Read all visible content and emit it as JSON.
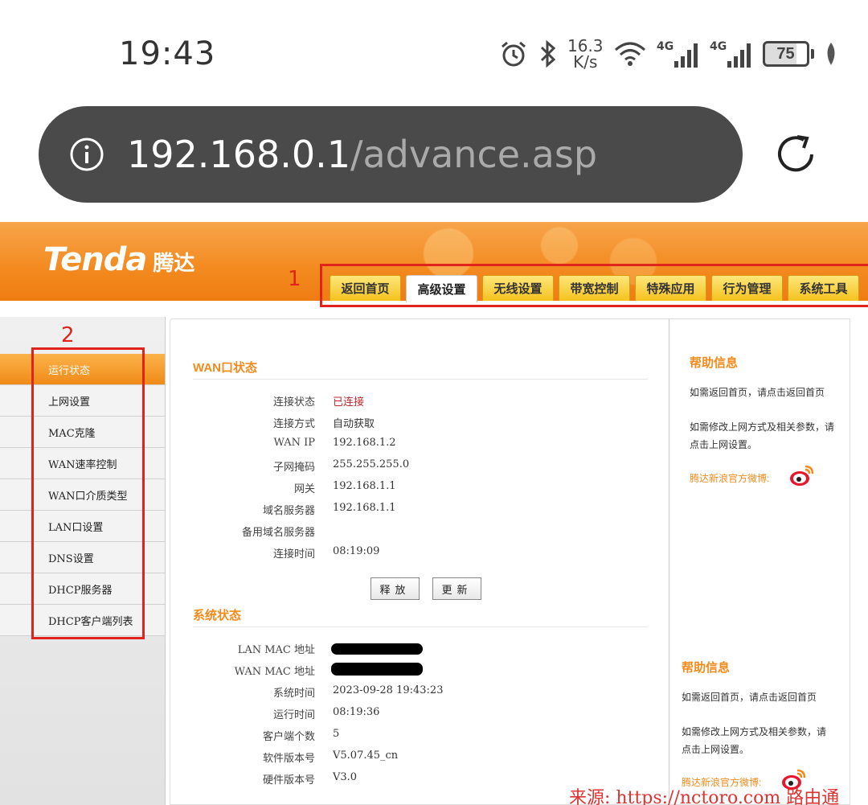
{
  "status_bar": {
    "time": "19:43",
    "net_speed_value": "16.3",
    "net_speed_unit": "K/s",
    "signal1_label": "4G",
    "signal2_label": "4G",
    "battery": "75"
  },
  "browser": {
    "url_host": "192.168.0.1",
    "url_path": "/advance.asp"
  },
  "router": {
    "brand_logo": "Tenda",
    "brand_cn": "腾达",
    "annotation_1": "1",
    "annotation_2": "2",
    "tabs": [
      {
        "label": "返回首页"
      },
      {
        "label": "高级设置",
        "active": true
      },
      {
        "label": "无线设置"
      },
      {
        "label": "带宽控制"
      },
      {
        "label": "特殊应用"
      },
      {
        "label": "行为管理"
      },
      {
        "label": "系统工具"
      }
    ],
    "sidebar": [
      {
        "label": "运行状态",
        "active": true
      },
      {
        "label": "上网设置"
      },
      {
        "label": "MAC克隆"
      },
      {
        "label": "WAN速率控制"
      },
      {
        "label": "WAN口介质类型"
      },
      {
        "label": "LAN口设置"
      },
      {
        "label": "DNS设置"
      },
      {
        "label": "DHCP服务器"
      },
      {
        "label": "DHCP客户端列表"
      }
    ],
    "wan_section": {
      "title": "WAN口状态",
      "rows": [
        {
          "label": "连接状态",
          "value": "已连接"
        },
        {
          "label": "连接方式",
          "value": "自动获取"
        },
        {
          "label": "WAN IP",
          "value": "192.168.1.2"
        },
        {
          "label": "子网掩码",
          "value": "255.255.255.0"
        },
        {
          "label": "网关",
          "value": "192.168.1.1"
        },
        {
          "label": "域名服务器",
          "value": "192.168.1.1"
        },
        {
          "label": "备用域名服务器",
          "value": ""
        },
        {
          "label": "连接时间",
          "value": "08:19:09"
        }
      ],
      "release_button": "释放",
      "renew_button": "更新"
    },
    "system_section": {
      "title": "系统状态",
      "rows": [
        {
          "label": "LAN MAC 地址",
          "value": ""
        },
        {
          "label": "WAN MAC 地址",
          "value": ""
        },
        {
          "label": "系统时间",
          "value": "2023-09-28 19:43:23"
        },
        {
          "label": "运行时间",
          "value": "08:19:36"
        },
        {
          "label": "客户端个数",
          "value": "5"
        },
        {
          "label": "软件版本号",
          "value": "V5.07.45_cn"
        },
        {
          "label": "硬件版本号",
          "value": "V3.0"
        }
      ]
    },
    "help": {
      "title": "帮助信息",
      "text1": "如需返回首页，请点击返回首页",
      "text2": "如需修改上网方式及相关参数，请点击上网设置。",
      "weibo_label": "腾达新浪官方微博:"
    }
  },
  "watermark": "来源: https://nctoro.com 路由通"
}
